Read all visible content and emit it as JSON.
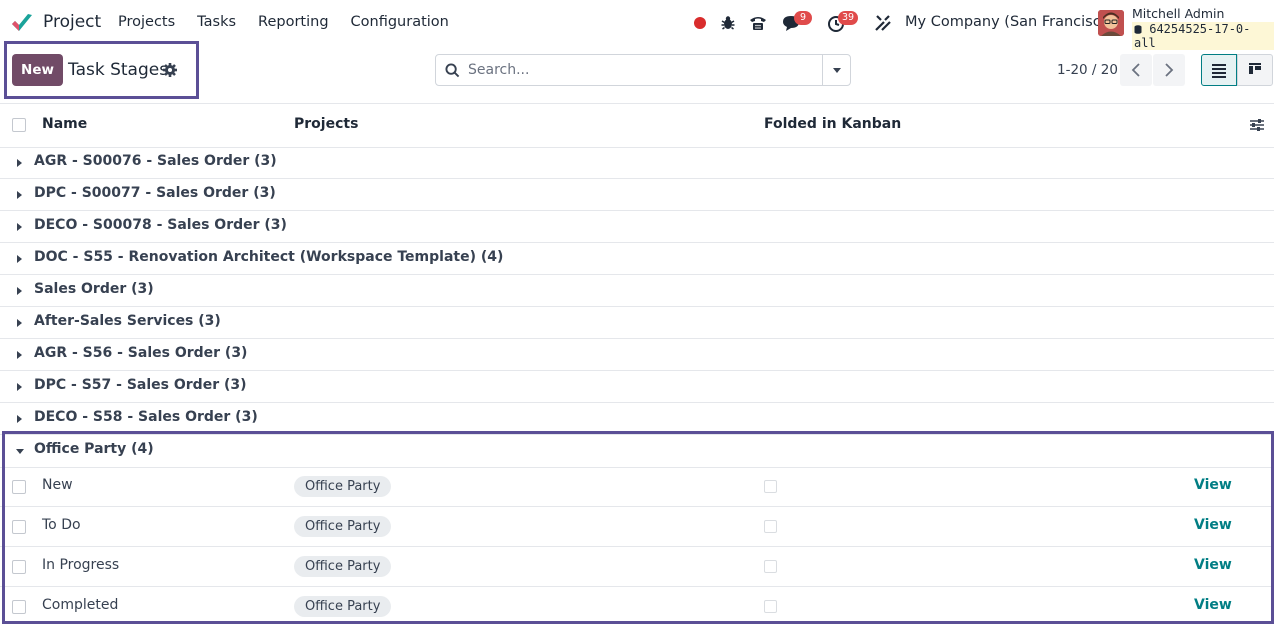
{
  "navbar": {
    "app_name": "Project",
    "menu": [
      "Projects",
      "Tasks",
      "Reporting",
      "Configuration"
    ],
    "messages_badge": "9",
    "activities_badge": "39",
    "company": "My Company (San Francisco)",
    "user_name": "Mitchell Admin",
    "database": "64254525-17-0-all",
    "colors": {
      "brand": "#714b67",
      "badge": "#e04b4b",
      "record": "#d92c2c"
    },
    "icons": [
      "app-logo-icon",
      "record-icon",
      "bug-icon",
      "phone-icon",
      "chat-icon",
      "clock-icon",
      "tools-icon",
      "database-icon"
    ]
  },
  "control_panel": {
    "new_label": "New",
    "title": "Task Stages",
    "search_placeholder": "Search...",
    "pager": "1-20 / 20",
    "highlight_color": "#5b4f96"
  },
  "table": {
    "columns": {
      "name": "Name",
      "projects": "Projects",
      "folded": "Folded in Kanban"
    },
    "groups": [
      {
        "label": "AGR - S00076 - Sales Order (3)",
        "expanded": false
      },
      {
        "label": "DPC - S00077 - Sales Order (3)",
        "expanded": false
      },
      {
        "label": "DECO - S00078 - Sales Order (3)",
        "expanded": false
      },
      {
        "label": "DOC - S55 - Renovation Architect (Workspace Template) (4)",
        "expanded": false
      },
      {
        "label": "Sales Order (3)",
        "expanded": false
      },
      {
        "label": "After-Sales Services (3)",
        "expanded": false
      },
      {
        "label": "AGR - S56 - Sales Order (3)",
        "expanded": false
      },
      {
        "label": "DPC - S57 - Sales Order (3)",
        "expanded": false
      },
      {
        "label": "DECO - S58 - Sales Order (3)",
        "expanded": false
      },
      {
        "label": "Office Party (4)",
        "expanded": true
      }
    ],
    "rows": [
      {
        "name": "New",
        "project": "Office Party",
        "folded": false,
        "action": "View"
      },
      {
        "name": "To Do",
        "project": "Office Party",
        "folded": false,
        "action": "View"
      },
      {
        "name": "In Progress",
        "project": "Office Party",
        "folded": false,
        "action": "View"
      },
      {
        "name": "Completed",
        "project": "Office Party",
        "folded": false,
        "action": "View"
      }
    ],
    "link_color": "#017e84"
  }
}
